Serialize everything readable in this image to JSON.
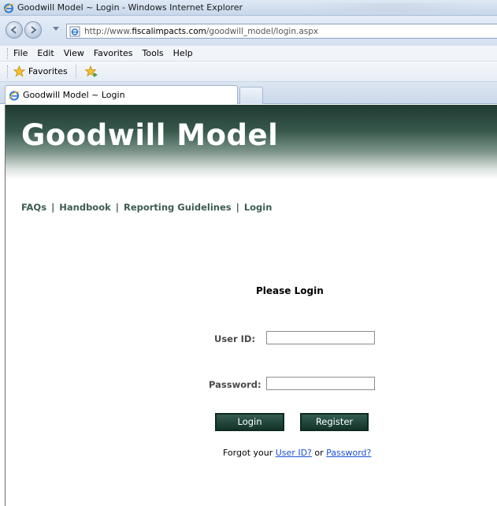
{
  "window": {
    "title": "Goodwill Model ~ Login - Windows Internet Explorer"
  },
  "address": {
    "url_prefix": "http://www.",
    "url_domain": "fiscalimpacts.com",
    "url_path": "/goodwill_model/login.aspx"
  },
  "menu": {
    "items": [
      "File",
      "Edit",
      "View",
      "Favorites",
      "Tools",
      "Help"
    ]
  },
  "favorites_bar": {
    "favorites_label": "Favorites"
  },
  "tab": {
    "title": "Goodwill Model ~ Login"
  },
  "page": {
    "banner_title": "Goodwill Model",
    "nav": {
      "links": [
        "FAQs",
        "Handbook",
        "Reporting Guidelines",
        "Login"
      ],
      "separator": "|"
    },
    "login": {
      "heading": "Please Login",
      "user_label": "User ID:",
      "user_value": "",
      "password_label": "Password:",
      "password_value": "",
      "login_button": "Login",
      "register_button": "Register",
      "forgot_prefix": "Forgot your",
      "forgot_user_link": "User ID?",
      "forgot_or": "or",
      "forgot_password_link": "Password?"
    }
  },
  "colors": {
    "brand_dark_green": "#1f3b32",
    "nav_link": "#3d5b52",
    "button_bg": "#13342a",
    "hyperlink": "#1a4fd6"
  }
}
